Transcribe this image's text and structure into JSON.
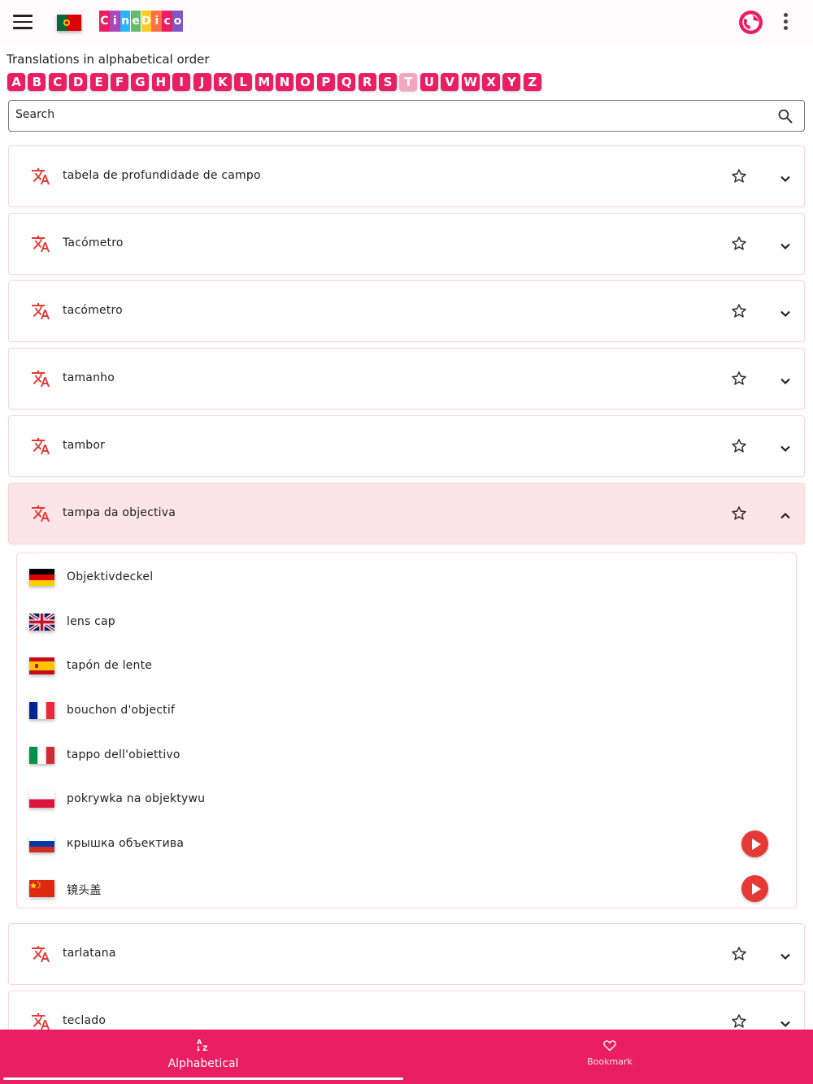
{
  "app": {
    "logo_text": "CineDico",
    "logo_colors": [
      "#e91e63",
      "#ab47bc",
      "#29b6f6",
      "#66bb6a",
      "#ffca28",
      "#ff7043",
      "#e91e63",
      "#7e57c2"
    ],
    "accent_color": "#e91e63",
    "current_language_flag": "flag-portugal",
    "icons": {
      "menu": "menu-icon",
      "language": "globe-icon",
      "more": "more-vert-icon"
    }
  },
  "heading": "Translations in alphabetical order",
  "alphabet": {
    "letters": [
      "A",
      "B",
      "C",
      "D",
      "E",
      "F",
      "G",
      "H",
      "I",
      "J",
      "K",
      "L",
      "M",
      "N",
      "O",
      "P",
      "Q",
      "R",
      "S",
      "T",
      "U",
      "V",
      "W",
      "X",
      "Y",
      "Z"
    ],
    "selected": "T"
  },
  "search": {
    "placeholder": "Search",
    "value": ""
  },
  "terms": [
    {
      "text": "tabela de profundidade de campo",
      "expanded": false
    },
    {
      "text": "Tacómetro",
      "expanded": false
    },
    {
      "text": "tacómetro",
      "expanded": false
    },
    {
      "text": "tamanho",
      "expanded": false
    },
    {
      "text": "tambor",
      "expanded": false
    },
    {
      "text": "tampa da objectiva",
      "expanded": true
    },
    {
      "text": "tarlatana",
      "expanded": false
    },
    {
      "text": "teclado",
      "expanded": false
    }
  ],
  "translations": [
    {
      "lang": "de",
      "flag": "flag-germany",
      "text": "Objektivdeckel",
      "audio": false
    },
    {
      "lang": "en",
      "flag": "flag-uk",
      "text": "lens cap",
      "audio": false
    },
    {
      "lang": "es",
      "flag": "flag-spain",
      "text": "tapón de lente",
      "audio": false
    },
    {
      "lang": "fr",
      "flag": "flag-france",
      "text": "bouchon d'objectif",
      "audio": false
    },
    {
      "lang": "it",
      "flag": "flag-italy",
      "text": "tappo dell'obiettivo",
      "audio": false
    },
    {
      "lang": "pl",
      "flag": "flag-poland",
      "text": "pokrywka na objektywu",
      "audio": false
    },
    {
      "lang": "ru",
      "flag": "flag-russia",
      "text": "крышка объектива",
      "audio": true
    },
    {
      "lang": "zh",
      "flag": "flag-china",
      "text": "镜头盖",
      "audio": true
    }
  ],
  "bottom_nav": {
    "alphabetical": {
      "label": "Alphabetical",
      "icon": "sort-az-icon",
      "selected": true
    },
    "bookmark": {
      "label": "Bookmark",
      "icon": "heart-icon",
      "selected": false
    }
  }
}
